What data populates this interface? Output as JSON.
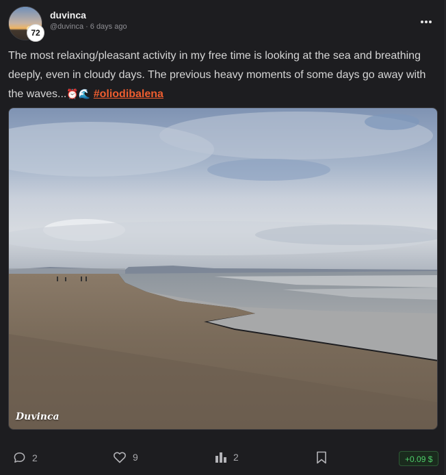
{
  "author": {
    "name": "duvinca",
    "handle": "@duvinca",
    "separator": "·",
    "time": "6 days ago",
    "reputation": "72"
  },
  "post": {
    "text": "The most relaxing/pleasant activity in my free time is looking at the sea and breathing deeply, even in cloudy days. The previous heavy moments of some days go away with the waves...",
    "emojis": "⏰🌊",
    "hashtag": "#oliodibalena",
    "image_watermark": "Duvinca"
  },
  "actions": {
    "comments": "2",
    "likes": "9",
    "reblogs": "2",
    "payout": "+0.09 $"
  },
  "icons": {
    "comment": "comment-icon",
    "like": "heart-icon",
    "reblog": "bar-chart-icon",
    "bookmark": "bookmark-icon",
    "more": "more-dots-icon"
  },
  "colors": {
    "background": "#1d1d20",
    "hashtag": "#ee5d2f",
    "payout": "#4fcf6a"
  }
}
